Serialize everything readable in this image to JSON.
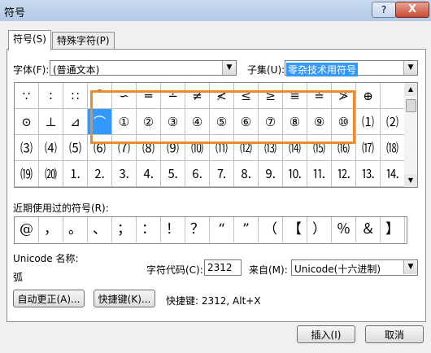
{
  "window": {
    "title": "符号",
    "help_label": "?",
    "close_label": "X"
  },
  "tabs": [
    {
      "label": "符号(S)"
    },
    {
      "label": "特殊字符(P)"
    }
  ],
  "font": {
    "label": "字体(F):",
    "value": "(普通文本)"
  },
  "subset": {
    "label": "子集(U):",
    "value": "零杂技术用符号"
  },
  "symbol_grid": {
    "rows": [
      [
        "∵",
        "∶",
        "∷",
        "⌒",
        "∽",
        "═",
        "∸",
        "≠",
        "≮",
        "≤",
        "≥",
        "≡",
        "≐",
        "≯",
        "⊕"
      ],
      [
        "⊙",
        "⊥",
        "⊿",
        "⌒",
        "①",
        "②",
        "③",
        "④",
        "⑤",
        "⑥",
        "⑦",
        "⑧",
        "⑨",
        "⑩",
        "⑴",
        "⑵"
      ],
      [
        "⑶",
        "⑷",
        "⑸",
        "⑹",
        "⑺",
        "⑻",
        "⑼",
        "⑽",
        "⑾",
        "⑿",
        "⒀",
        "⒁",
        "⒂",
        "⒃",
        "⒄",
        "⒅"
      ],
      [
        "⒆",
        "⒇",
        "⒈",
        "⒉",
        "⒊",
        "⒋",
        "⒌",
        "⒍",
        "⒎",
        "⒏",
        "⒐",
        "⒑",
        "⒒",
        "⒓",
        "⒔",
        "⒕"
      ]
    ],
    "visible_rows": [
      [
        "∵",
        "∶",
        "∷",
        "⌒",
        "∽",
        "═",
        "∸",
        "≠",
        "≮",
        "≤",
        "≥",
        "≡",
        "≐",
        "≯",
        "⊕",
        ""
      ],
      [
        "⊙",
        "⊥",
        "⊿",
        "⌒",
        "①",
        "②",
        "③",
        "④",
        "⑤",
        "⑥",
        "⑦",
        "⑧",
        "⑨",
        "⑩",
        "⑴",
        "⑵"
      ],
      [
        "⑶",
        "⑷",
        "⑸",
        "⑹",
        "⑺",
        "⑻",
        "⑼",
        "⑽",
        "⑾",
        "⑿",
        "⒀",
        "⒁",
        "⒂",
        "⒃",
        "⒄",
        "⒅"
      ],
      [
        "⒆",
        "⒇",
        "⒈",
        "⒉",
        "⒊",
        "⒋",
        "⒌",
        "⒍",
        "⒎",
        "⒏",
        "⒐",
        "⒑",
        "⒒",
        "⒓",
        "⒔",
        "⒕"
      ]
    ],
    "selected": {
      "row": 1,
      "col": 3
    },
    "highlight_color": "#f08a2a"
  },
  "recent": {
    "label": "近期使用过的符号(R):",
    "symbols": [
      "@",
      "，",
      "。",
      "、",
      "；",
      "：",
      "！",
      "？",
      "“",
      "”",
      "（",
      "【",
      "）",
      "％",
      "＆",
      "】"
    ]
  },
  "unicode_name": {
    "label": "Unicode 名称:",
    "value": "弧"
  },
  "char_code": {
    "label": "字符代码(C):",
    "value": "2312"
  },
  "from": {
    "label": "来自(M):",
    "value": "Unicode(十六进制)"
  },
  "buttons": {
    "autocorrect": "自动更正(A)...",
    "shortcut_key": "快捷键(K)...",
    "insert": "插入(I)",
    "cancel": "取消"
  },
  "shortcut_text": "快捷键: 2312, Alt+X"
}
